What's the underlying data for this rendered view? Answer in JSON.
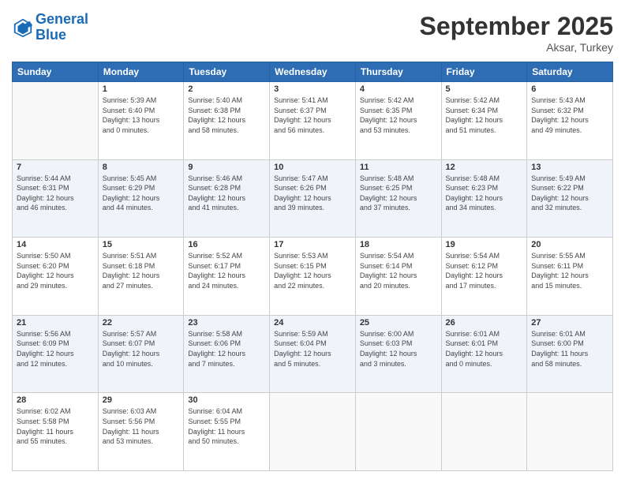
{
  "header": {
    "logo_line1": "General",
    "logo_line2": "Blue",
    "title": "September 2025",
    "location": "Aksar, Turkey"
  },
  "days_of_week": [
    "Sunday",
    "Monday",
    "Tuesday",
    "Wednesday",
    "Thursday",
    "Friday",
    "Saturday"
  ],
  "weeks": [
    [
      {
        "day": "",
        "info": ""
      },
      {
        "day": "1",
        "info": "Sunrise: 5:39 AM\nSunset: 6:40 PM\nDaylight: 13 hours\nand 0 minutes."
      },
      {
        "day": "2",
        "info": "Sunrise: 5:40 AM\nSunset: 6:38 PM\nDaylight: 12 hours\nand 58 minutes."
      },
      {
        "day": "3",
        "info": "Sunrise: 5:41 AM\nSunset: 6:37 PM\nDaylight: 12 hours\nand 56 minutes."
      },
      {
        "day": "4",
        "info": "Sunrise: 5:42 AM\nSunset: 6:35 PM\nDaylight: 12 hours\nand 53 minutes."
      },
      {
        "day": "5",
        "info": "Sunrise: 5:42 AM\nSunset: 6:34 PM\nDaylight: 12 hours\nand 51 minutes."
      },
      {
        "day": "6",
        "info": "Sunrise: 5:43 AM\nSunset: 6:32 PM\nDaylight: 12 hours\nand 49 minutes."
      }
    ],
    [
      {
        "day": "7",
        "info": "Sunrise: 5:44 AM\nSunset: 6:31 PM\nDaylight: 12 hours\nand 46 minutes."
      },
      {
        "day": "8",
        "info": "Sunrise: 5:45 AM\nSunset: 6:29 PM\nDaylight: 12 hours\nand 44 minutes."
      },
      {
        "day": "9",
        "info": "Sunrise: 5:46 AM\nSunset: 6:28 PM\nDaylight: 12 hours\nand 41 minutes."
      },
      {
        "day": "10",
        "info": "Sunrise: 5:47 AM\nSunset: 6:26 PM\nDaylight: 12 hours\nand 39 minutes."
      },
      {
        "day": "11",
        "info": "Sunrise: 5:48 AM\nSunset: 6:25 PM\nDaylight: 12 hours\nand 37 minutes."
      },
      {
        "day": "12",
        "info": "Sunrise: 5:48 AM\nSunset: 6:23 PM\nDaylight: 12 hours\nand 34 minutes."
      },
      {
        "day": "13",
        "info": "Sunrise: 5:49 AM\nSunset: 6:22 PM\nDaylight: 12 hours\nand 32 minutes."
      }
    ],
    [
      {
        "day": "14",
        "info": "Sunrise: 5:50 AM\nSunset: 6:20 PM\nDaylight: 12 hours\nand 29 minutes."
      },
      {
        "day": "15",
        "info": "Sunrise: 5:51 AM\nSunset: 6:18 PM\nDaylight: 12 hours\nand 27 minutes."
      },
      {
        "day": "16",
        "info": "Sunrise: 5:52 AM\nSunset: 6:17 PM\nDaylight: 12 hours\nand 24 minutes."
      },
      {
        "day": "17",
        "info": "Sunrise: 5:53 AM\nSunset: 6:15 PM\nDaylight: 12 hours\nand 22 minutes."
      },
      {
        "day": "18",
        "info": "Sunrise: 5:54 AM\nSunset: 6:14 PM\nDaylight: 12 hours\nand 20 minutes."
      },
      {
        "day": "19",
        "info": "Sunrise: 5:54 AM\nSunset: 6:12 PM\nDaylight: 12 hours\nand 17 minutes."
      },
      {
        "day": "20",
        "info": "Sunrise: 5:55 AM\nSunset: 6:11 PM\nDaylight: 12 hours\nand 15 minutes."
      }
    ],
    [
      {
        "day": "21",
        "info": "Sunrise: 5:56 AM\nSunset: 6:09 PM\nDaylight: 12 hours\nand 12 minutes."
      },
      {
        "day": "22",
        "info": "Sunrise: 5:57 AM\nSunset: 6:07 PM\nDaylight: 12 hours\nand 10 minutes."
      },
      {
        "day": "23",
        "info": "Sunrise: 5:58 AM\nSunset: 6:06 PM\nDaylight: 12 hours\nand 7 minutes."
      },
      {
        "day": "24",
        "info": "Sunrise: 5:59 AM\nSunset: 6:04 PM\nDaylight: 12 hours\nand 5 minutes."
      },
      {
        "day": "25",
        "info": "Sunrise: 6:00 AM\nSunset: 6:03 PM\nDaylight: 12 hours\nand 3 minutes."
      },
      {
        "day": "26",
        "info": "Sunrise: 6:01 AM\nSunset: 6:01 PM\nDaylight: 12 hours\nand 0 minutes."
      },
      {
        "day": "27",
        "info": "Sunrise: 6:01 AM\nSunset: 6:00 PM\nDaylight: 11 hours\nand 58 minutes."
      }
    ],
    [
      {
        "day": "28",
        "info": "Sunrise: 6:02 AM\nSunset: 5:58 PM\nDaylight: 11 hours\nand 55 minutes."
      },
      {
        "day": "29",
        "info": "Sunrise: 6:03 AM\nSunset: 5:56 PM\nDaylight: 11 hours\nand 53 minutes."
      },
      {
        "day": "30",
        "info": "Sunrise: 6:04 AM\nSunset: 5:55 PM\nDaylight: 11 hours\nand 50 minutes."
      },
      {
        "day": "",
        "info": ""
      },
      {
        "day": "",
        "info": ""
      },
      {
        "day": "",
        "info": ""
      },
      {
        "day": "",
        "info": ""
      }
    ]
  ]
}
